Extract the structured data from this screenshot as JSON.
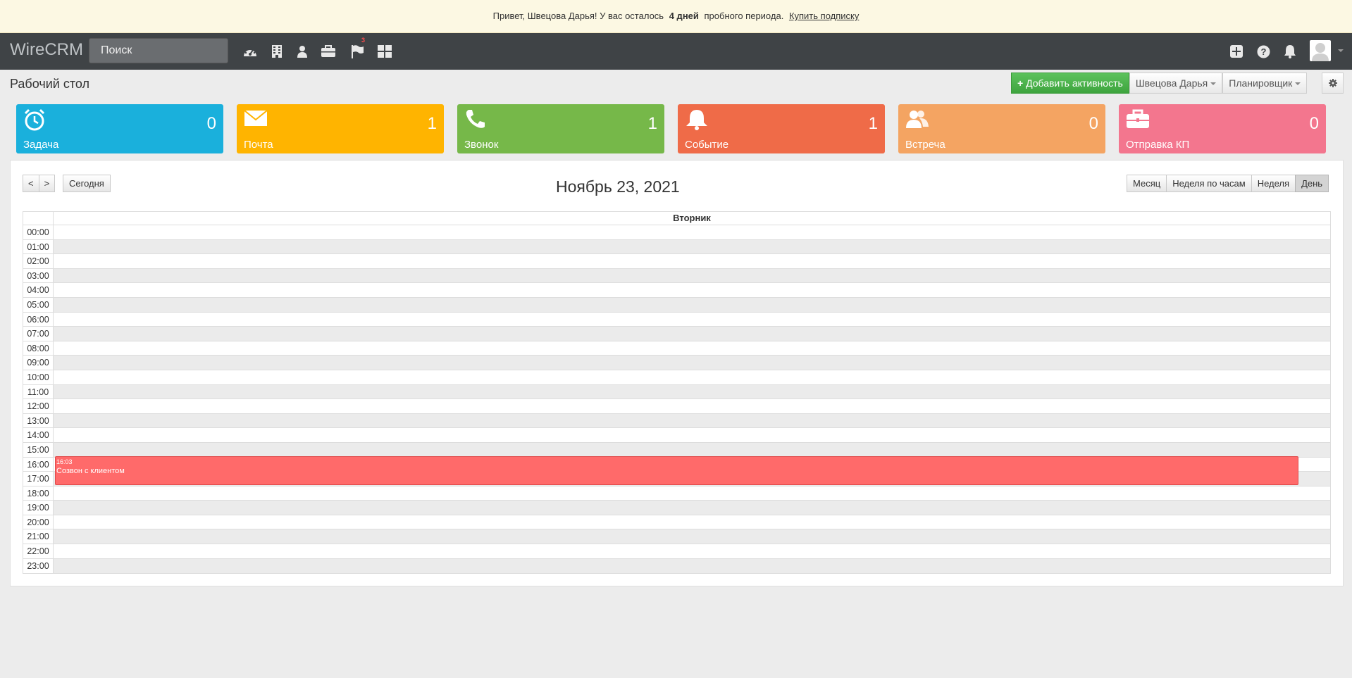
{
  "trial": {
    "prefix": "Привет, Швецова Дарья! У вас осталось",
    "days": "4 дней",
    "suffix": "пробного периода.",
    "link": "Купить подписку"
  },
  "navbar": {
    "brand": "WireCRM",
    "search_placeholder": "Поиск",
    "icons": [
      "dashboard-icon",
      "building-icon",
      "user-icon",
      "briefcase-icon",
      "flag-icon",
      "grid-icon"
    ],
    "flag_badge": "3",
    "right_icons": [
      "plus-square-icon",
      "question-icon",
      "bell-icon",
      "avatar"
    ]
  },
  "header": {
    "title": "Рабочий стол",
    "add_activity": "Добавить активность",
    "user_filter": "Швецова Дарья",
    "view_mode": "Планировщик"
  },
  "tiles": [
    {
      "label": "Задача",
      "count": "0",
      "color": "#1ab0dc",
      "icon": "clock-icon"
    },
    {
      "label": "Почта",
      "count": "1",
      "color": "#ffb400",
      "icon": "envelope-icon"
    },
    {
      "label": "Звонок",
      "count": "1",
      "color": "#76b849",
      "icon": "phone-icon"
    },
    {
      "label": "Событие",
      "count": "1",
      "color": "#ef6b48",
      "icon": "bell-icon"
    },
    {
      "label": "Встреча",
      "count": "0",
      "color": "#f4a462",
      "icon": "people-icon"
    },
    {
      "label": "Отправка КП",
      "count": "0",
      "color": "#f3768e",
      "icon": "briefcase-icon"
    }
  ],
  "calendar": {
    "prev": "<",
    "next": ">",
    "today": "Сегодня",
    "title": "Ноябрь 23, 2021",
    "views": [
      "Месяц",
      "Неделя по часам",
      "Неделя",
      "День"
    ],
    "active_view": "День",
    "day_header": "Вторник",
    "hours": [
      "00:00",
      "01:00",
      "02:00",
      "03:00",
      "04:00",
      "05:00",
      "06:00",
      "07:00",
      "08:00",
      "09:00",
      "10:00",
      "11:00",
      "12:00",
      "13:00",
      "14:00",
      "15:00",
      "16:00",
      "17:00",
      "18:00",
      "19:00",
      "20:00",
      "21:00",
      "22:00",
      "23:00"
    ],
    "event": {
      "time": "16:03",
      "title": "Созвон с клиентом",
      "color": "#ff6a6a"
    }
  }
}
